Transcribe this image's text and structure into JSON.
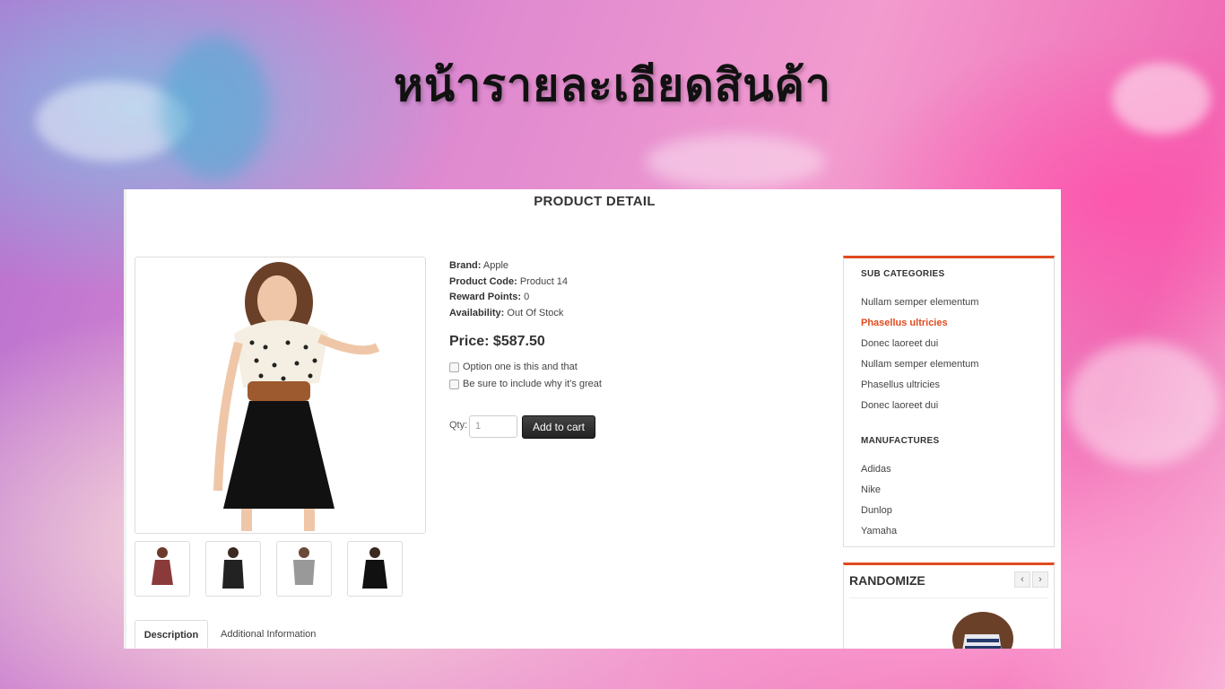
{
  "slide": {
    "title": "หน้ารายละเอียดสินค้า"
  },
  "page": {
    "heading": "PRODUCT DETAIL"
  },
  "product": {
    "brand_label": "Brand:",
    "brand": "Apple",
    "code_label": "Product Code:",
    "code": "Product 14",
    "reward_label": "Reward Points:",
    "reward": "0",
    "availability_label": "Availability:",
    "availability": "Out Of Stock",
    "price": "Price: $587.50",
    "options": [
      "Option one is this and that",
      "Be sure to include why it's great"
    ],
    "qty_label": "Qty:",
    "qty_placeholder": "1",
    "add_to_cart": "Add to cart"
  },
  "tabs": [
    {
      "label": "Description"
    },
    {
      "label": "Additional Information"
    }
  ],
  "sidebar": {
    "sub_categories_title": "SUB CATEGORIES",
    "sub_categories": [
      "Nullam semper elementum",
      "Phasellus ultricies",
      "Donec laoreet dui",
      "Nullam semper elementum",
      "Phasellus ultricies",
      "Donec laoreet dui"
    ],
    "manufactures_title": "MANUFACTURES",
    "manufactures": [
      "Adidas",
      "Nike",
      "Dunlop",
      "Yamaha"
    ],
    "randomize_title": "RANDOMIZE",
    "prev_icon": "‹",
    "next_icon": "›"
  },
  "colors": {
    "accent": "#e04b1f",
    "button": "#222222"
  }
}
